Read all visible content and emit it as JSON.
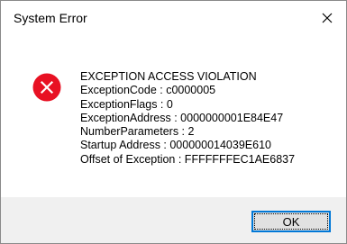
{
  "window": {
    "title": "System Error",
    "close_icon": "close-icon"
  },
  "dialog": {
    "icon": "error-icon",
    "icon_color": "#e81123",
    "lines": [
      "EXCEPTION ACCESS VIOLATION",
      "ExceptionCode : c0000005",
      "ExceptionFlags : 0",
      "ExceptionAddress : 0000000001E84E47",
      "NumberParameters : 2",
      "Startup Address : 000000014039E610",
      "Offset of Exception : FFFFFFFEC1AE6837"
    ]
  },
  "footer": {
    "ok_label": "OK",
    "focus_color": "#0078d7"
  }
}
